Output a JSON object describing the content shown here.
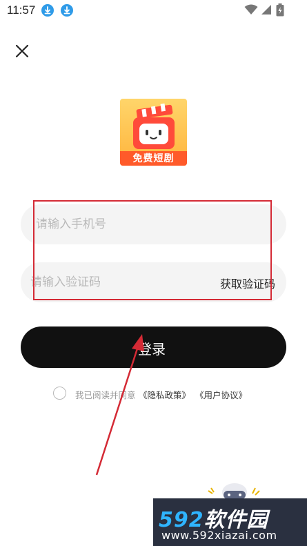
{
  "status_bar": {
    "time": "11:57"
  },
  "logo": {
    "text": "免费短剧"
  },
  "form": {
    "phone_placeholder": "请输入手机号",
    "code_placeholder": "请输入验证码",
    "get_code_label": "获取验证码",
    "login_label": "登录"
  },
  "agreement": {
    "prefix": "我已阅读并同意",
    "privacy_link": "《隐私政策》",
    "terms_link": "《用户协议》"
  },
  "watermark": {
    "number": "592",
    "brand": "软件园",
    "url": "www.592xiazai.com"
  },
  "colors": {
    "accent_red": "#d42a35",
    "button_black": "#111111",
    "input_bg": "#f4f4f4"
  }
}
